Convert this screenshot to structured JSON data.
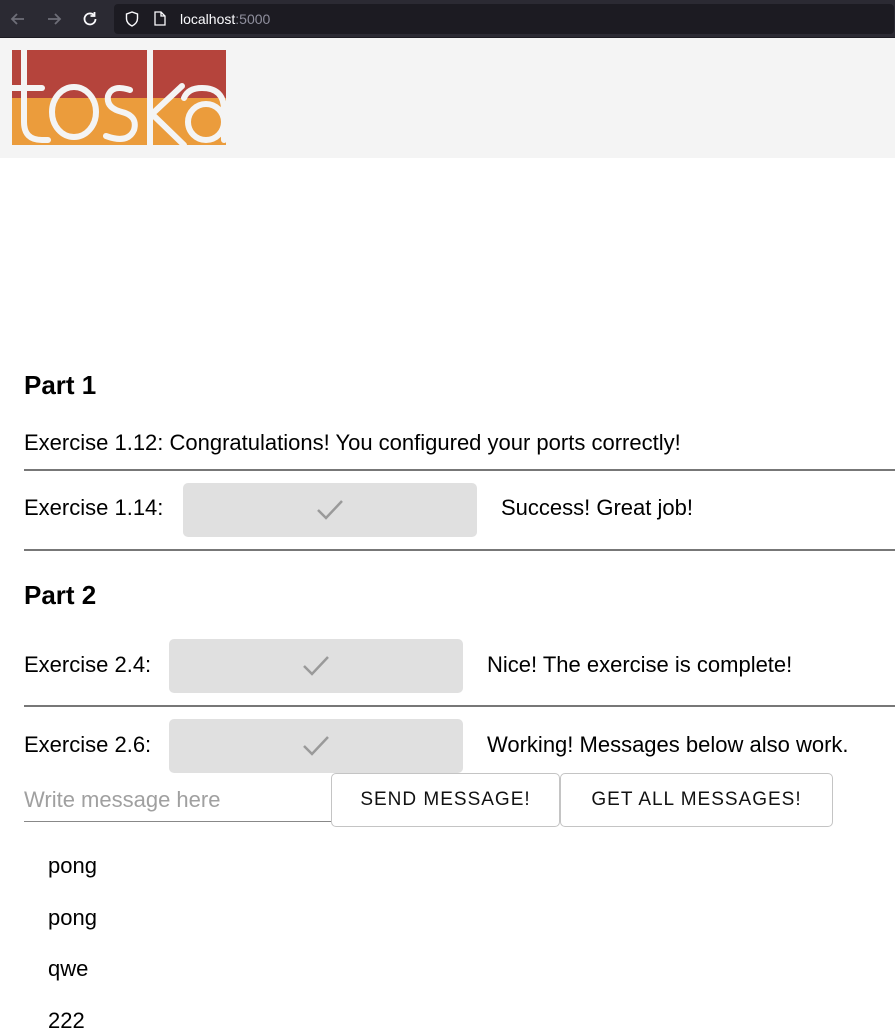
{
  "browser": {
    "url_host": "localhost",
    "url_port": ":5000"
  },
  "header": {
    "logo_text": "toska",
    "logo_colors": {
      "top": "#b5443c",
      "bottom": "#eb9c3c"
    }
  },
  "part1": {
    "title": "Part 1",
    "ex_1_12": "Exercise 1.12: Congratulations! You configured your ports correctly!",
    "ex_1_14_label": "Exercise 1.14:",
    "ex_1_14_status": "Success! Great job!"
  },
  "part2": {
    "title": "Part 2",
    "ex_2_4_label": "Exercise 2.4:",
    "ex_2_4_status": "Nice! The exercise is complete!",
    "ex_2_6_label": "Exercise 2.6:",
    "ex_2_6_status": "Working! Messages below also work."
  },
  "messages": {
    "input_placeholder": "Write message here",
    "send_label": "SEND MESSAGE!",
    "get_label": "GET ALL MESSAGES!",
    "items": [
      "pong",
      "pong",
      "qwe",
      "222"
    ]
  },
  "icons": {
    "back": "arrow-left-icon",
    "forward": "arrow-right-icon",
    "reload": "reload-icon",
    "shield": "shield-icon",
    "page": "page-icon",
    "check": "checkmark-icon"
  }
}
